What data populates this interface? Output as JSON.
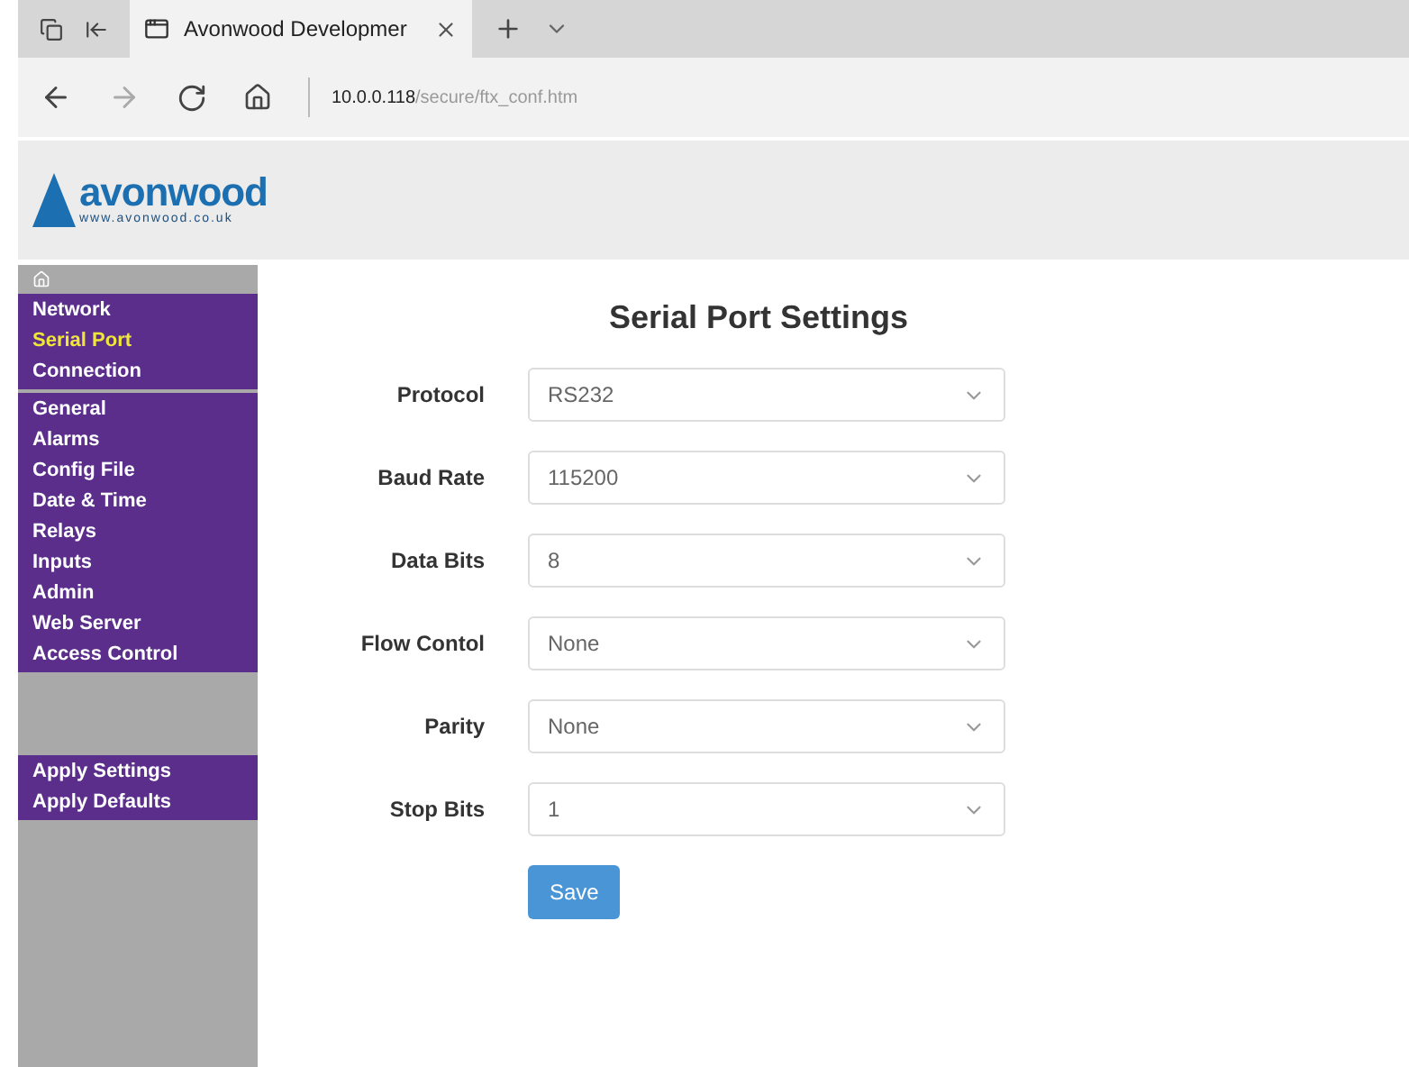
{
  "browser": {
    "tab": {
      "title": "Avonwood Developmer",
      "selected": true
    },
    "address": {
      "host": "10.0.0.118",
      "path": "/secure/ftx_conf.htm"
    }
  },
  "logo": {
    "name": "avonwood",
    "url": "www.avonwood.co.uk"
  },
  "sidebar": {
    "groups": [
      {
        "kind": "menu",
        "items": [
          {
            "label": "Network",
            "selected": false
          },
          {
            "label": "Serial Port",
            "selected": true
          },
          {
            "label": "Connection",
            "selected": false
          }
        ]
      },
      {
        "kind": "menu",
        "items": [
          {
            "label": "General",
            "selected": false
          },
          {
            "label": "Alarms",
            "selected": false
          },
          {
            "label": "Config File",
            "selected": false
          },
          {
            "label": "Date & Time",
            "selected": false
          },
          {
            "label": "Relays",
            "selected": false
          },
          {
            "label": "Inputs",
            "selected": false
          },
          {
            "label": "Admin",
            "selected": false
          },
          {
            "label": "Web Server",
            "selected": false
          },
          {
            "label": "Access Control",
            "selected": false
          }
        ]
      },
      {
        "kind": "spacer"
      },
      {
        "kind": "menu",
        "items": [
          {
            "label": "Apply Settings",
            "selected": false
          },
          {
            "label": "Apply Defaults",
            "selected": false
          }
        ]
      }
    ]
  },
  "form": {
    "title": "Serial Port Settings",
    "fields": [
      {
        "label": "Protocol",
        "value": "RS232"
      },
      {
        "label": "Baud Rate",
        "value": "115200"
      },
      {
        "label": "Data Bits",
        "value": "8"
      },
      {
        "label": "Flow Contol",
        "value": "None"
      },
      {
        "label": "Parity",
        "value": "None"
      },
      {
        "label": "Stop Bits",
        "value": "1"
      }
    ],
    "button": "Save"
  }
}
